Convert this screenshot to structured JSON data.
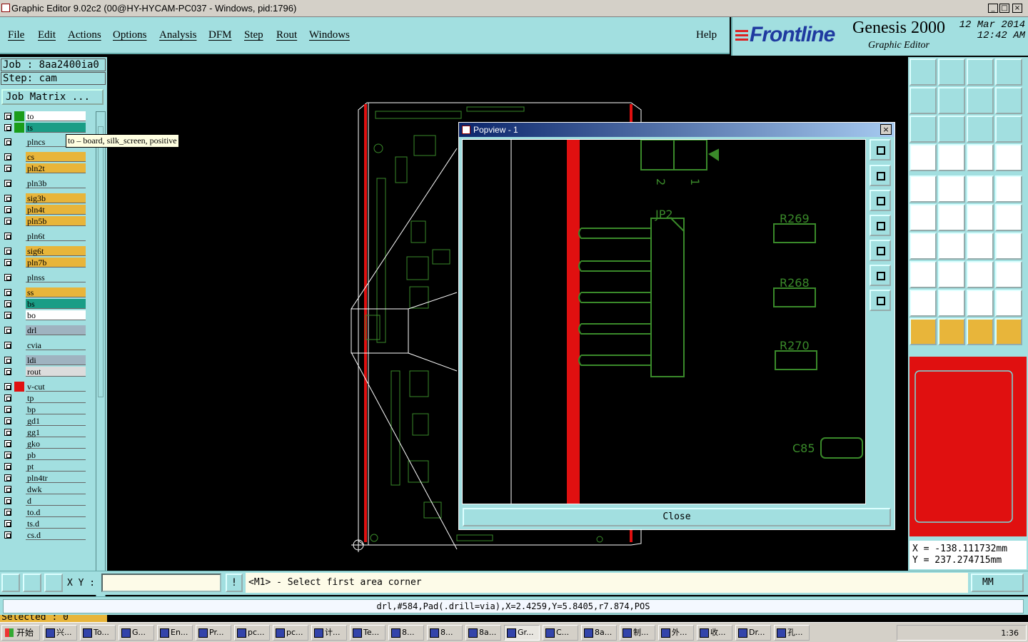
{
  "window": {
    "title": "Graphic Editor 9.02c2 (00@HY-HYCAM-PC037 - Windows, pid:1796)"
  },
  "menu": {
    "items": [
      "File",
      "Edit",
      "Actions",
      "Options",
      "Analysis",
      "DFM",
      "Step",
      "Rout",
      "Windows"
    ],
    "help": "Help"
  },
  "brand": {
    "logo": "Frontline",
    "product": "Genesis 2000",
    "subtitle": "Graphic Editor",
    "date": "12 Mar 2014",
    "time": "12:42 AM"
  },
  "left": {
    "job": "Job : 8aa2400ia0",
    "step": "Step: cam",
    "job_matrix": "Job Matrix ...",
    "layers": [
      {
        "name": "to",
        "color": "#ffffff",
        "swatch": "#1a9d1a"
      },
      {
        "name": "ts",
        "color": "#1a9d86",
        "swatch": "#1a9d1a"
      },
      {
        "name": "plncs",
        "color": "#a2dfe0",
        "swatch": "#a2dfe0"
      },
      {
        "name": "cs",
        "color": "#e8b53a",
        "swatch": "#a2dfe0"
      },
      {
        "name": "pln2t",
        "color": "#e8b53a",
        "swatch": "#a2dfe0"
      },
      {
        "name": "pln3b",
        "color": "#a2dfe0",
        "swatch": "#a2dfe0"
      },
      {
        "name": "sig3b",
        "color": "#e8b53a",
        "swatch": "#a2dfe0"
      },
      {
        "name": "pln4t",
        "color": "#e8b53a",
        "swatch": "#a2dfe0"
      },
      {
        "name": "pln5b",
        "color": "#e8b53a",
        "swatch": "#a2dfe0"
      },
      {
        "name": "pln6t",
        "color": "#a2dfe0",
        "swatch": "#a2dfe0"
      },
      {
        "name": "sig6t",
        "color": "#e8b53a",
        "swatch": "#a2dfe0"
      },
      {
        "name": "pln7b",
        "color": "#e8b53a",
        "swatch": "#a2dfe0"
      },
      {
        "name": "plnss",
        "color": "#a2dfe0",
        "swatch": "#a2dfe0"
      },
      {
        "name": "ss",
        "color": "#e8b53a",
        "swatch": "#a2dfe0"
      },
      {
        "name": "bs",
        "color": "#1a9d86",
        "swatch": "#a2dfe0"
      },
      {
        "name": "bo",
        "color": "#ffffff",
        "swatch": "#a2dfe0"
      },
      {
        "name": "drl",
        "color": "#9fb3c0",
        "swatch": "#a2dfe0"
      },
      {
        "name": "cvia",
        "color": "#a2dfe0",
        "swatch": "#a2dfe0"
      },
      {
        "name": "ldi",
        "color": "#9fb3c0",
        "swatch": "#a2dfe0"
      },
      {
        "name": "rout",
        "color": "#dcdcdc",
        "swatch": "#a2dfe0"
      },
      {
        "name": "v-cut",
        "color": "#a2dfe0",
        "swatch": "#e01010"
      },
      {
        "name": "tp",
        "color": "#a2dfe0",
        "swatch": "#a2dfe0"
      },
      {
        "name": "bp",
        "color": "#a2dfe0",
        "swatch": "#a2dfe0"
      },
      {
        "name": "gd1",
        "color": "#a2dfe0",
        "swatch": "#a2dfe0"
      },
      {
        "name": "gg1",
        "color": "#a2dfe0",
        "swatch": "#a2dfe0"
      },
      {
        "name": "gko",
        "color": "#a2dfe0",
        "swatch": "#a2dfe0"
      },
      {
        "name": "pb",
        "color": "#a2dfe0",
        "swatch": "#a2dfe0"
      },
      {
        "name": "pt",
        "color": "#a2dfe0",
        "swatch": "#a2dfe0"
      },
      {
        "name": "pln4tr",
        "color": "#a2dfe0",
        "swatch": "#a2dfe0"
      },
      {
        "name": "dwk",
        "color": "#a2dfe0",
        "swatch": "#a2dfe0"
      },
      {
        "name": "d",
        "color": "#a2dfe0",
        "swatch": "#a2dfe0"
      },
      {
        "name": "to.d",
        "color": "#a2dfe0",
        "swatch": "#a2dfe0"
      },
      {
        "name": "ts.d",
        "color": "#a2dfe0",
        "swatch": "#a2dfe0"
      },
      {
        "name": "cs.d",
        "color": "#a2dfe0",
        "swatch": "#a2dfe0"
      }
    ],
    "selected": "Selected : 0",
    "tooltip": "to – board, silk_screen, positive"
  },
  "popview": {
    "title": "Popview - 1",
    "close_label": "Close",
    "labels": {
      "jp2": "JP2",
      "r269": "R269",
      "r268": "R268",
      "r270": "R270",
      "c85": "C85",
      "pin2": "2",
      "pin1": "1"
    }
  },
  "right": {
    "coord_x": "X = -138.111732mm",
    "coord_y": "Y = 237.274715mm"
  },
  "bottom": {
    "xy_label": "X Y :",
    "xy_value": "",
    "prompt": "<M1> - Select first area corner",
    "units": "MM",
    "status": "drl,#584,Pad(.drill=via),X=2.4259,Y=5.8405,r7.874,POS"
  },
  "taskbar": {
    "start": "开始",
    "tasks": [
      "兴...",
      "To...",
      "G...",
      "En...",
      "Pr...",
      "pc...",
      "pc...",
      "计...",
      "Te...",
      "8...",
      "8...",
      "8a...",
      "Gr...",
      "C...",
      "8a...",
      "制...",
      "外...",
      "收...",
      "Dr...",
      "孔..."
    ],
    "clock": "1:36"
  }
}
